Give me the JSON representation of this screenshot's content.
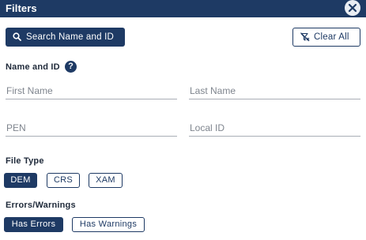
{
  "header": {
    "title": "Filters",
    "close_icon": "close-icon"
  },
  "actions": {
    "search_label": "Search Name and ID",
    "search_icon": "search-icon",
    "clear_label": "Clear All",
    "clear_icon": "filter-clear-icon"
  },
  "name_and_id": {
    "label": "Name and ID",
    "help_icon": "help-icon",
    "help_glyph": "?",
    "fields": {
      "first_name": {
        "placeholder": "First Name",
        "value": ""
      },
      "last_name": {
        "placeholder": "Last Name",
        "value": ""
      },
      "pen": {
        "placeholder": "PEN",
        "value": ""
      },
      "local_id": {
        "placeholder": "Local ID",
        "value": ""
      }
    }
  },
  "file_type": {
    "label": "File Type",
    "options": [
      {
        "label": "DEM",
        "selected": true
      },
      {
        "label": "CRS",
        "selected": false
      },
      {
        "label": "XAM",
        "selected": false
      }
    ]
  },
  "errors_warnings": {
    "label": "Errors/Warnings",
    "options": [
      {
        "label": "Has Errors",
        "selected": true
      },
      {
        "label": "Has Warnings",
        "selected": false
      }
    ]
  },
  "colors": {
    "primary": "#1e3a64",
    "muted_text": "#7f858e",
    "underline": "#a9aeb6"
  }
}
